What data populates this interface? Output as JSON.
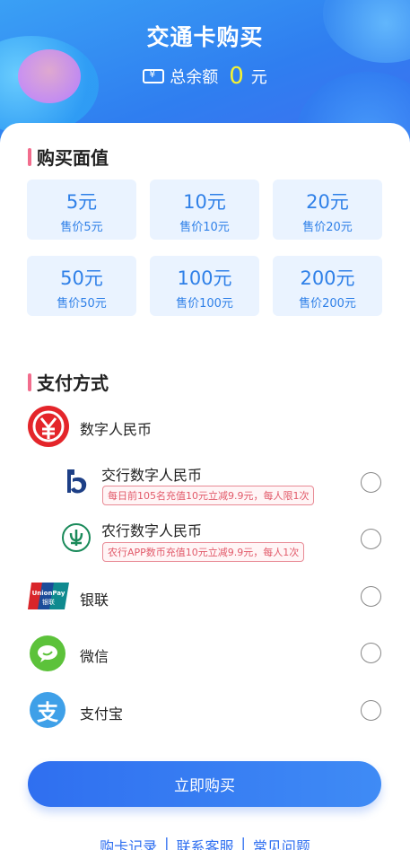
{
  "header": {
    "title": "交通卡购买",
    "balance_label": "总余额",
    "balance_value": "0",
    "balance_unit": "元"
  },
  "purchase": {
    "section_title": "购买面值",
    "options": [
      {
        "face": "5元",
        "price": "售价5元"
      },
      {
        "face": "10元",
        "price": "售价10元"
      },
      {
        "face": "20元",
        "price": "售价20元"
      },
      {
        "face": "50元",
        "price": "售价50元"
      },
      {
        "face": "100元",
        "price": "售价100元"
      },
      {
        "face": "200元",
        "price": "售价200元"
      }
    ]
  },
  "payment": {
    "section_title": "支付方式",
    "group_label": "数字人民币",
    "methods": [
      {
        "label": "交行数字人民币",
        "promo": "每日前105名充值10元立减9.9元，每人限1次",
        "icon": "bocom-icon"
      },
      {
        "label": "农行数字人民币",
        "promo": "农行APP数币充值10元立减9.9元，每人1次",
        "icon": "abc-icon"
      },
      {
        "label": "银联",
        "icon": "unionpay-icon"
      },
      {
        "label": "微信",
        "icon": "wechat-icon"
      },
      {
        "label": "支付宝",
        "icon": "alipay-icon"
      }
    ]
  },
  "buy_button": "立即购买",
  "footer": {
    "links": [
      "购卡记录",
      "联系客服",
      "常见问题"
    ]
  },
  "colors": {
    "primary": "#2f6ff0",
    "tile_bg": "#eaf3ff",
    "balance_highlight": "#f5f233",
    "promo_red": "#e25a6a",
    "ecny_red": "#e4252a"
  }
}
